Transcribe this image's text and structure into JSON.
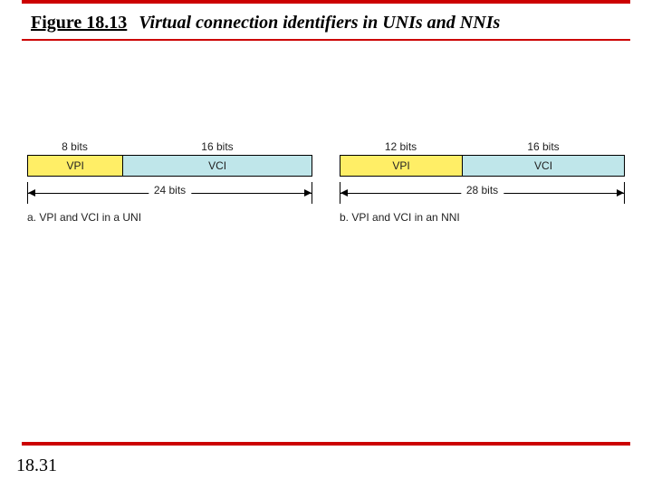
{
  "header": {
    "figure_number": "Figure 18.13",
    "figure_title": "Virtual connection identifiers in UNIs and NNIs"
  },
  "diagrams": {
    "a": {
      "vpi_bits": "8 bits",
      "vci_bits": "16 bits",
      "vpi_label": "VPI",
      "vci_label": "VCI",
      "total_bits": "24 bits",
      "vpi_fraction": 0.3333,
      "vci_fraction": 0.6667,
      "caption": "a. VPI and VCI in a UNI"
    },
    "b": {
      "vpi_bits": "12 bits",
      "vci_bits": "16 bits",
      "vpi_label": "VPI",
      "vci_label": "VCI",
      "total_bits": "28 bits",
      "vpi_fraction": 0.4286,
      "vci_fraction": 0.5714,
      "caption": "b. VPI and VCI in an NNI"
    }
  },
  "page_number": "18.31",
  "colors": {
    "rule": "#cc0000",
    "vpi_fill": "#ffee66",
    "vci_fill": "#bfe6ea"
  }
}
